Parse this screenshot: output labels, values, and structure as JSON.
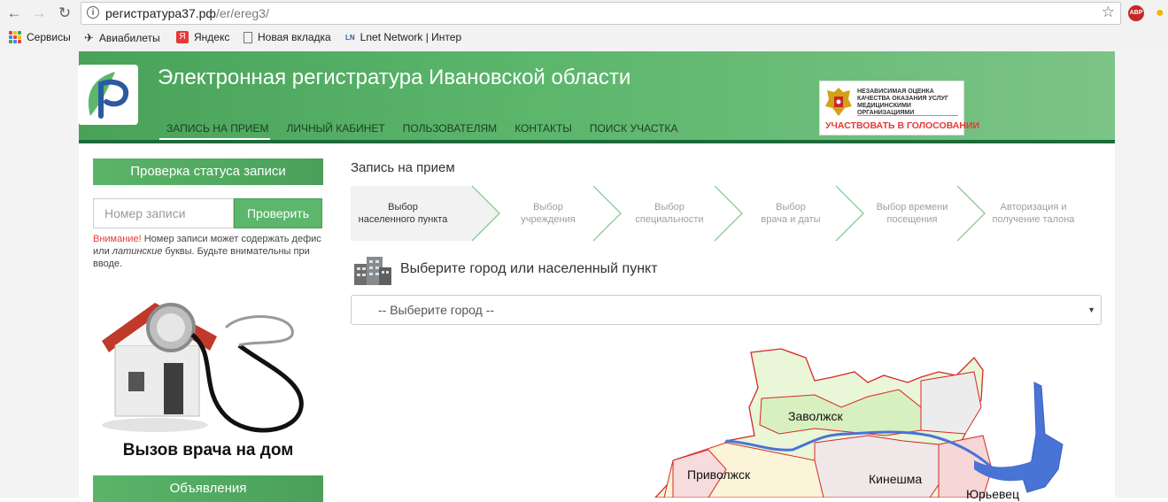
{
  "browser": {
    "url_host": "регистратура37.рф",
    "url_path": "/er/ereg3/",
    "bookmarks": [
      {
        "label": "Сервисы",
        "icon": "apps-icon"
      },
      {
        "label": "Авиабилеты",
        "icon": "plane-icon"
      },
      {
        "label": "Яндекс",
        "icon": "yandex-icon"
      },
      {
        "label": "Новая вкладка",
        "icon": "page-icon"
      },
      {
        "label": "Lnet Network | Интер",
        "icon": "lnet-icon"
      }
    ],
    "extension_label": "ABP"
  },
  "header": {
    "title": "Электронная регистратура Ивановской области",
    "nav": [
      "ЗАПИСЬ НА ПРИЕМ",
      "ЛИЧНЫЙ КАБИНЕТ",
      "ПОЛЬЗОВАТЕЛЯМ",
      "КОНТАКТЫ",
      "ПОИСК УЧАСТКА"
    ],
    "vote": {
      "text": "НЕЗАВИСИМАЯ ОЦЕНКА\nКАЧЕСТВА ОКАЗАНИЯ УСЛУГ\nМЕДИЦИНСКИМИ ОРГАНИЗАЦИЯМИ",
      "button": "УЧАСТВОВАТЬ В ГОЛОСОВАНИИ"
    }
  },
  "sidebar": {
    "status_title": "Проверка статуса записи",
    "record_placeholder": "Номер записи",
    "check_button": "Проверить",
    "note_warn": "Внимание!",
    "note_text1": " Номер записи может содержать дефис или ",
    "note_italic": "латинские",
    "note_text2": " буквы. Будьте внимательны при вводе.",
    "promo_caption": "Вызов врача на дом",
    "ads_title": "Объявления"
  },
  "main": {
    "title": "Запись на прием",
    "steps": [
      {
        "line1": "Выбор",
        "line2": "населенного пункта",
        "active": true
      },
      {
        "line1": "Выбор",
        "line2": "учреждения",
        "active": false
      },
      {
        "line1": "Выбор",
        "line2": "специальности",
        "active": false
      },
      {
        "line1": "Выбор",
        "line2": "врача и даты",
        "active": false
      },
      {
        "line1": "Выбор времени",
        "line2": "посещения",
        "active": false
      },
      {
        "line1": "Авторизация и",
        "line2": "получение талона",
        "active": false
      }
    ],
    "city_label": "Выберите город или населенный пункт",
    "city_select": "-- Выберите город --",
    "map_labels": [
      "Заволжск",
      "Приволжск",
      "Кинешма",
      "Юрьевец"
    ]
  },
  "colors": {
    "brand_green": "#5cb66c",
    "dark_green": "#1d6b3a",
    "warn_red": "#e53935"
  }
}
